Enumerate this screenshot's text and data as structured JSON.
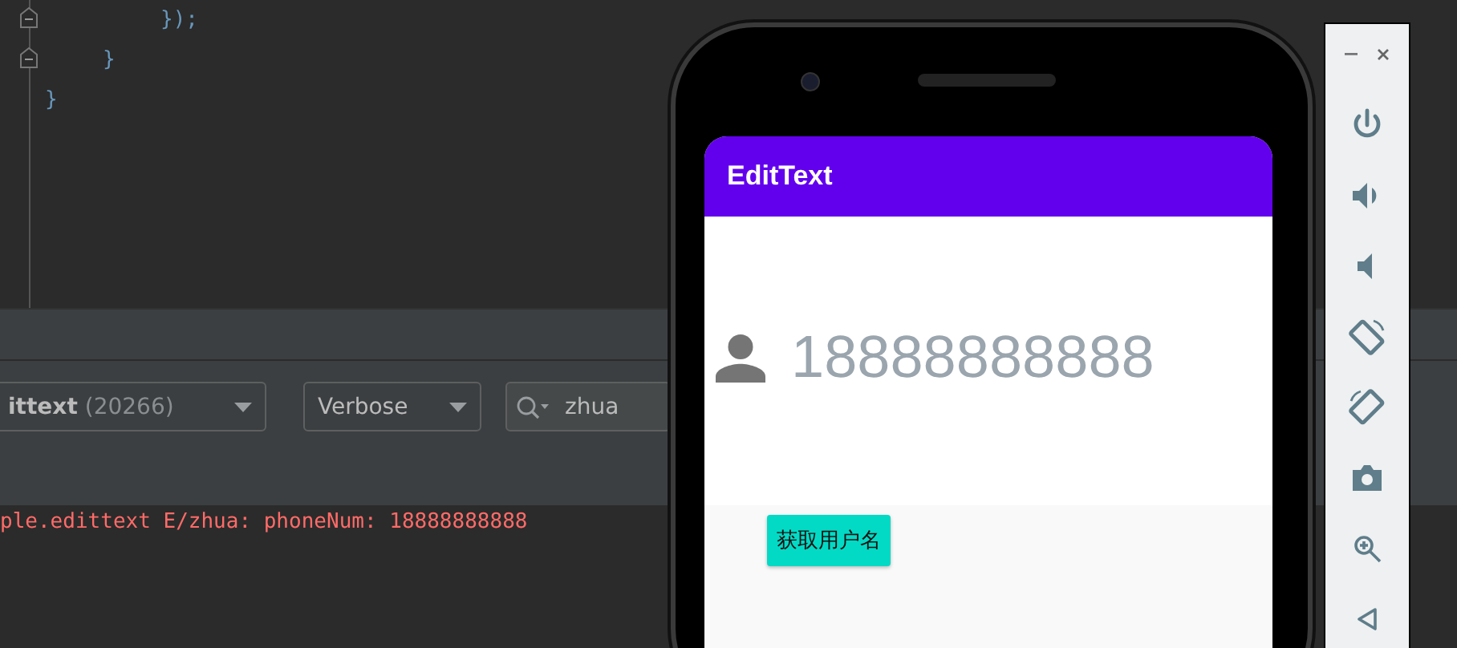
{
  "editor": {
    "lines": [
      {
        "text": "});",
        "fold": true
      },
      {
        "text": "}",
        "fold": true
      },
      {
        "text": "}",
        "fold": false
      }
    ]
  },
  "logcat": {
    "process": "**ittext** (20266)",
    "log_level": "Verbose",
    "search": {
      "value": "zhua"
    },
    "messages": [
      {
        "text": "ple.edittext E/zhua: phoneNum: 18888888888",
        "color": "#ff6b68"
      }
    ]
  },
  "phone": {
    "app_bar": {
      "title": "EditText"
    },
    "field": {
      "value": "18888888888"
    },
    "button": "获取用户名"
  },
  "emulator_toolbar": {
    "tools": [
      {
        "kind": "minimize"
      },
      {
        "kind": "close"
      },
      {
        "kind": "power"
      },
      {
        "kind": "volume-up"
      },
      {
        "kind": "volume-down"
      },
      {
        "kind": "rotate-left"
      },
      {
        "kind": "rotate-right"
      },
      {
        "kind": "screenshot"
      },
      {
        "kind": "zoom"
      },
      {
        "kind": "back"
      }
    ]
  }
}
